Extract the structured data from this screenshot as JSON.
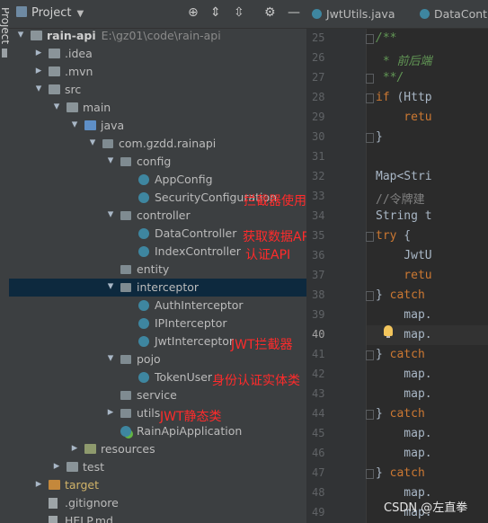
{
  "side_strip": {
    "tab_label": "Project"
  },
  "header": {
    "title": "Project"
  },
  "tree": [
    {
      "text": "rain-api",
      "path": "E:\\gz01\\code\\rain-api",
      "arrow": "down",
      "icon": "folder-icon",
      "depth": 0,
      "bold": true
    },
    {
      "text": ".idea",
      "arrow": "right",
      "icon": "folder-icon",
      "depth": 1
    },
    {
      "text": ".mvn",
      "arrow": "right",
      "icon": "folder-icon",
      "depth": 1
    },
    {
      "text": "src",
      "arrow": "down",
      "icon": "folder-icon",
      "depth": 1
    },
    {
      "text": "main",
      "arrow": "down",
      "icon": "folder-icon",
      "depth": 2
    },
    {
      "text": "java",
      "arrow": "down",
      "icon": "source-folder-icon",
      "depth": 3
    },
    {
      "text": "com.gzdd.rainapi",
      "arrow": "down",
      "icon": "package-icon",
      "depth": 4
    },
    {
      "text": "config",
      "arrow": "down",
      "icon": "package-icon",
      "depth": 5
    },
    {
      "text": "AppConfig",
      "arrow": "",
      "icon": "class-icon",
      "depth": 6
    },
    {
      "text": "SecurityConfiguration",
      "arrow": "",
      "icon": "class-icon",
      "depth": 6
    },
    {
      "text": "controller",
      "arrow": "down",
      "icon": "package-icon",
      "depth": 5
    },
    {
      "text": "DataController",
      "arrow": "",
      "icon": "class-icon",
      "depth": 6
    },
    {
      "text": "IndexController",
      "arrow": "",
      "icon": "class-icon",
      "depth": 6
    },
    {
      "text": "entity",
      "arrow": "",
      "icon": "package-icon",
      "depth": 5
    },
    {
      "text": "interceptor",
      "arrow": "down",
      "icon": "package-icon",
      "depth": 5,
      "selected": true
    },
    {
      "text": "AuthInterceptor",
      "arrow": "",
      "icon": "class-icon",
      "depth": 6
    },
    {
      "text": "IPInterceptor",
      "arrow": "",
      "icon": "class-icon",
      "depth": 6
    },
    {
      "text": "JwtInterceptor",
      "arrow": "",
      "icon": "class-icon",
      "depth": 6
    },
    {
      "text": "pojo",
      "arrow": "down",
      "icon": "package-icon",
      "depth": 5
    },
    {
      "text": "TokenUser",
      "arrow": "",
      "icon": "class-icon",
      "depth": 6
    },
    {
      "text": "service",
      "arrow": "",
      "icon": "package-icon",
      "depth": 5
    },
    {
      "text": "utils",
      "arrow": "right",
      "icon": "package-icon",
      "depth": 5
    },
    {
      "text": "RainApiApplication",
      "arrow": "",
      "icon": "app-class-icon",
      "depth": 5
    },
    {
      "text": "resources",
      "arrow": "right",
      "icon": "resources-folder-icon",
      "depth": 3
    },
    {
      "text": "test",
      "arrow": "right",
      "icon": "folder-icon",
      "depth": 2
    },
    {
      "text": "target",
      "arrow": "right",
      "icon": "target-folder-icon",
      "depth": 1,
      "target": true
    },
    {
      "text": ".gitignore",
      "arrow": "",
      "icon": "file-icon",
      "depth": 1
    },
    {
      "text": "HELP.md",
      "arrow": "",
      "icon": "file-icon",
      "depth": 1
    }
  ],
  "annotations": [
    {
      "text": "拦截器使用",
      "row": 10
    },
    {
      "text": "获取数据API",
      "row": 12
    },
    {
      "text": "认证API",
      "row": 13
    },
    {
      "text": "JWT拦截器",
      "row": 18
    },
    {
      "text": "身份认证实体类",
      "row": 20
    },
    {
      "text": "JWT静态类",
      "row": 22
    }
  ],
  "editor": {
    "tabs": [
      {
        "label": "JwtUtils.java",
        "icon": "class-icon"
      },
      {
        "label": "DataContro",
        "icon": "class-icon"
      }
    ],
    "lines": [
      {
        "n": "25",
        "parts": [
          {
            "t": "/**",
            "c": "doc"
          }
        ]
      },
      {
        "n": "26",
        "parts": [
          {
            "t": " * 前后端",
            "c": "doc"
          }
        ]
      },
      {
        "n": "27",
        "parts": [
          {
            "t": " **/",
            "c": "doc"
          }
        ]
      },
      {
        "n": "28",
        "parts": [
          {
            "t": "if (Http",
            "c": "kwmix"
          }
        ]
      },
      {
        "n": "29",
        "parts": [
          {
            "t": "    retu",
            "c": "kw"
          }
        ]
      },
      {
        "n": "30",
        "parts": [
          {
            "t": "}",
            "c": "txt"
          }
        ]
      },
      {
        "n": "31",
        "parts": []
      },
      {
        "n": "32",
        "parts": [
          {
            "t": "Map<Stri",
            "c": "txt"
          }
        ]
      },
      {
        "n": "33",
        "parts": [
          {
            "t": "//令牌建",
            "c": "cmt"
          }
        ]
      },
      {
        "n": "34",
        "parts": [
          {
            "t": "String t",
            "c": "txt"
          }
        ]
      },
      {
        "n": "35",
        "parts": [
          {
            "t": "try {",
            "c": "kwmix"
          }
        ]
      },
      {
        "n": "36",
        "parts": [
          {
            "t": "    JwtU",
            "c": "txt"
          }
        ]
      },
      {
        "n": "37",
        "parts": [
          {
            "t": "    retu",
            "c": "kw"
          }
        ]
      },
      {
        "n": "38",
        "parts": [
          {
            "t": "} catch",
            "c": "kwmix"
          }
        ]
      },
      {
        "n": "39",
        "parts": [
          {
            "t": "    map.",
            "c": "txt"
          }
        ]
      },
      {
        "n": "40",
        "parts": [
          {
            "t": "    map.",
            "c": "txt"
          }
        ],
        "highlight": true
      },
      {
        "n": "41",
        "parts": [
          {
            "t": "} catch",
            "c": "kwmix"
          }
        ]
      },
      {
        "n": "42",
        "parts": [
          {
            "t": "    map.",
            "c": "txt"
          }
        ]
      },
      {
        "n": "43",
        "parts": [
          {
            "t": "    map.",
            "c": "txt"
          }
        ]
      },
      {
        "n": "44",
        "parts": [
          {
            "t": "} catch",
            "c": "kwmix"
          }
        ]
      },
      {
        "n": "45",
        "parts": [
          {
            "t": "    map.",
            "c": "txt"
          }
        ]
      },
      {
        "n": "46",
        "parts": [
          {
            "t": "    map.",
            "c": "txt"
          }
        ]
      },
      {
        "n": "47",
        "parts": [
          {
            "t": "} catch",
            "c": "kwmix"
          }
        ]
      },
      {
        "n": "48",
        "parts": [
          {
            "t": "    map.",
            "c": "txt"
          }
        ]
      },
      {
        "n": "49",
        "parts": [
          {
            "t": "    map.",
            "c": "txt"
          }
        ]
      }
    ]
  },
  "watermark": "CSDN @左直拳",
  "colors": {
    "selection": "#0d293e",
    "annotation": "#ff2b2b",
    "keyword": "#cc7832",
    "doc_comment": "#629755"
  }
}
